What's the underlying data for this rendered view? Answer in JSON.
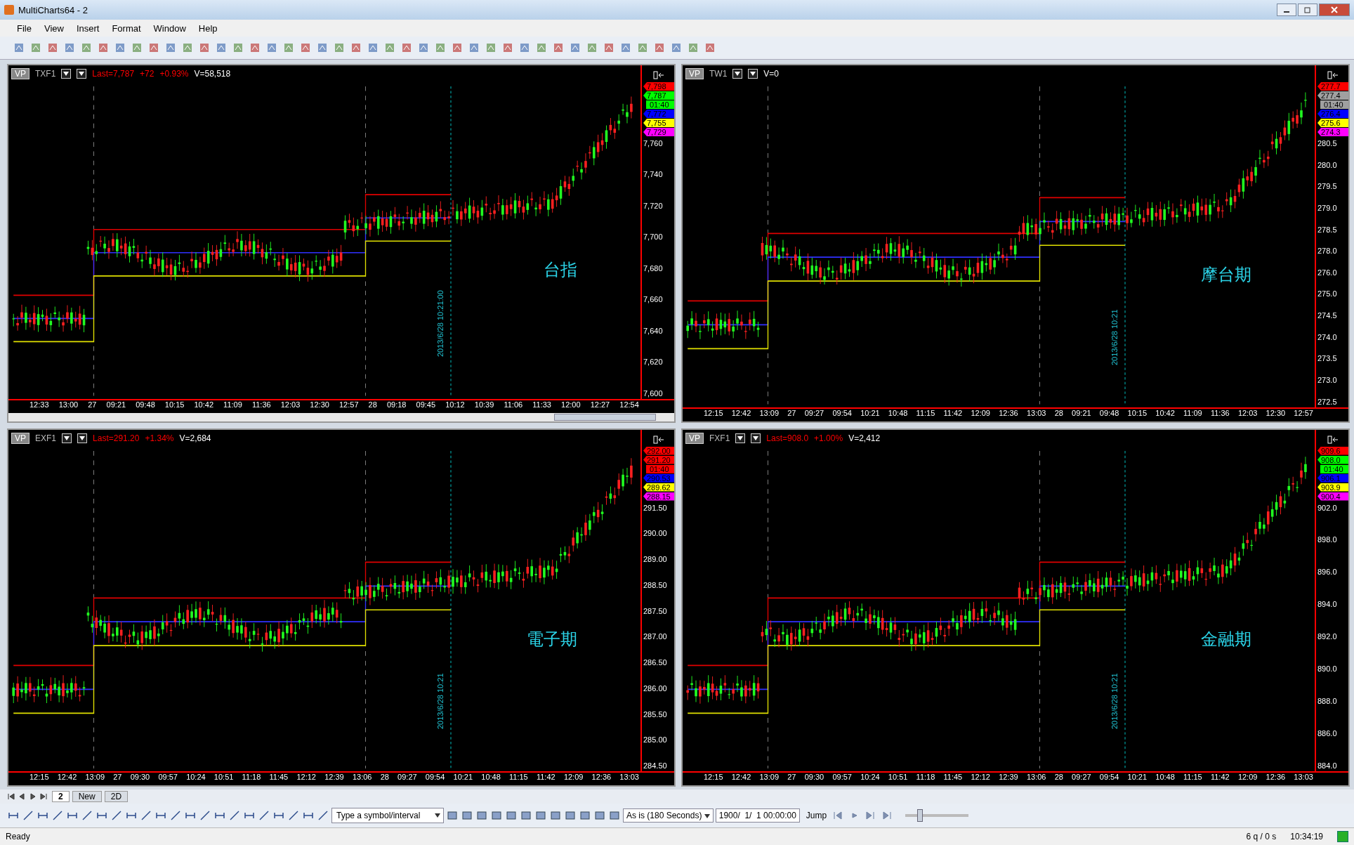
{
  "window": {
    "title": "MultiCharts64 - 2"
  },
  "menu": [
    "File",
    "View",
    "Insert",
    "Format",
    "Window",
    "Help"
  ],
  "charts": [
    {
      "badge": "VP",
      "symbol": "TXF1",
      "last": "Last=7,787",
      "change": "+72",
      "percent": "+0.93%",
      "volume": "V=58,518",
      "market_label": "台指",
      "cursor_label": "2013/6/28 10:21:00",
      "scrollbar": true,
      "yticks": [
        "7,760",
        "7,740",
        "7,720",
        "7,700",
        "7,680",
        "7,660",
        "7,640",
        "7,620",
        "7,600"
      ],
      "tags": [
        {
          "text": "7,798",
          "color": "#ff0000"
        },
        {
          "text": "7,787",
          "color": "#00ff00"
        },
        {
          "text": "01:40",
          "color": "#00ff00"
        },
        {
          "text": "7,772",
          "color": "#0000ff"
        },
        {
          "text": "7,755",
          "color": "#ffff00"
        },
        {
          "text": "7,729",
          "color": "#ff00ff"
        }
      ],
      "xticks": [
        "12:33",
        "13:00",
        "27",
        "09:21",
        "09:48",
        "10:15",
        "10:42",
        "11:09",
        "11:36",
        "12:03",
        "12:30",
        "12:57",
        "28",
        "09:18",
        "09:45",
        "10:12",
        "10:39",
        "11:06",
        "11:33",
        "12:00",
        "12:27",
        "12:54"
      ]
    },
    {
      "badge": "VP",
      "symbol": "TW1",
      "volume": "V=0",
      "market_label": "摩台期",
      "cursor_label": "2013/6/28 10:21",
      "scrollbar": false,
      "yticks": [
        "280.5",
        "280.0",
        "279.5",
        "279.0",
        "278.5",
        "278.0",
        "276.0",
        "275.0",
        "274.5",
        "274.0",
        "273.5",
        "273.0",
        "272.5"
      ],
      "tags": [
        {
          "text": "277.7",
          "color": "#ff0000"
        },
        {
          "text": "277.4",
          "color": "#a0a0a0"
        },
        {
          "text": "01:40",
          "color": "#a0a0a0"
        },
        {
          "text": "276.4",
          "color": "#0000ff"
        },
        {
          "text": "275.6",
          "color": "#ffff00"
        },
        {
          "text": "274.3",
          "color": "#ff00ff"
        }
      ],
      "xticks": [
        "12:15",
        "12:42",
        "13:09",
        "27",
        "09:27",
        "09:54",
        "10:21",
        "10:48",
        "11:15",
        "11:42",
        "12:09",
        "12:36",
        "13:03",
        "28",
        "09:21",
        "09:48",
        "10:15",
        "10:42",
        "11:09",
        "11:36",
        "12:03",
        "12:30",
        "12:57"
      ]
    },
    {
      "badge": "VP",
      "symbol": "EXF1",
      "last": "Last=291.20",
      "percent": "+1.34%",
      "volume": "V=2,684",
      "market_label": "電子期",
      "cursor_label": "2013/6/28 10:21",
      "scrollbar": false,
      "yticks": [
        "291.50",
        "290.00",
        "289.00",
        "288.50",
        "287.50",
        "287.00",
        "286.50",
        "286.00",
        "285.50",
        "285.00",
        "284.50"
      ],
      "tags": [
        {
          "text": "292.00",
          "color": "#ff0000"
        },
        {
          "text": "291.20",
          "color": "#ff0000"
        },
        {
          "text": "01:40",
          "color": "#ff0000"
        },
        {
          "text": "290.53",
          "color": "#0000ff"
        },
        {
          "text": "289.62",
          "color": "#ffff00"
        },
        {
          "text": "288.15",
          "color": "#ff00ff"
        }
      ],
      "xticks": [
        "12:15",
        "12:42",
        "13:09",
        "27",
        "09:30",
        "09:57",
        "10:24",
        "10:51",
        "11:18",
        "11:45",
        "12:12",
        "12:39",
        "13:06",
        "28",
        "09:27",
        "09:54",
        "10:21",
        "10:48",
        "11:15",
        "11:42",
        "12:09",
        "12:36",
        "13:03"
      ]
    },
    {
      "badge": "VP",
      "symbol": "FXF1",
      "last": "Last=908.0",
      "percent": "+1.00%",
      "volume": "V=2,412",
      "market_label": "金融期",
      "cursor_label": "2013/6/28 10:21",
      "scrollbar": false,
      "yticks": [
        "902.0",
        "898.0",
        "896.0",
        "894.0",
        "892.0",
        "890.0",
        "888.0",
        "886.0",
        "884.0"
      ],
      "tags": [
        {
          "text": "909.6",
          "color": "#ff0000"
        },
        {
          "text": "908.0",
          "color": "#00ff00"
        },
        {
          "text": "01:40",
          "color": "#00ff00"
        },
        {
          "text": "906.1",
          "color": "#0000ff"
        },
        {
          "text": "903.9",
          "color": "#ffff00"
        },
        {
          "text": "900.4",
          "color": "#ff00ff"
        }
      ],
      "xticks": [
        "12:15",
        "12:42",
        "13:09",
        "27",
        "09:30",
        "09:57",
        "10:24",
        "10:51",
        "11:18",
        "11:45",
        "12:12",
        "12:39",
        "13:06",
        "28",
        "09:27",
        "09:54",
        "10:21",
        "10:48",
        "11:15",
        "11:42",
        "12:09",
        "12:36",
        "13:03"
      ]
    }
  ],
  "sheet_tabs": [
    {
      "label": "2",
      "selected": true
    },
    {
      "label": "New",
      "selected": false
    },
    {
      "label": "2D",
      "selected": false
    }
  ],
  "symbol_field": {
    "placeholder": "Type a symbol/interval"
  },
  "resolution": "As is (180 Seconds)",
  "date_field": "1900/  1/  1 00:00:00",
  "jump": "Jump",
  "zoom_slider": {
    "level": 0.2
  },
  "status_bar": {
    "text": "Ready",
    "queue": "6 q / 0 s",
    "time": "10:34:19"
  }
}
